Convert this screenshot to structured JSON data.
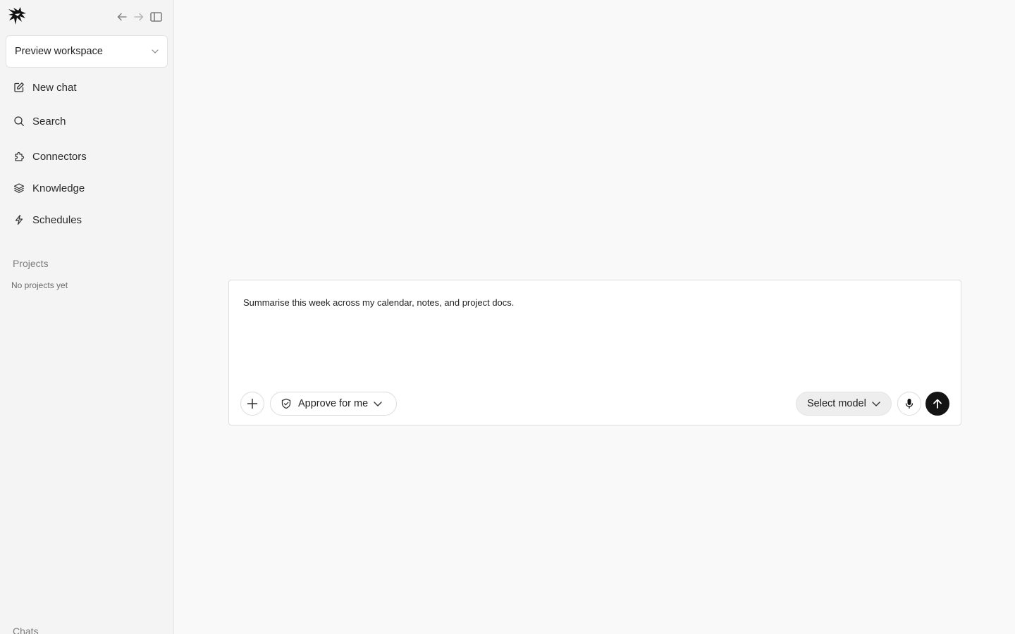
{
  "sidebar": {
    "workspace": {
      "label": "Preview workspace"
    },
    "nav": [
      {
        "label": "New chat",
        "icon": "edit-icon"
      },
      {
        "label": "Search",
        "icon": "search-icon"
      },
      {
        "label": "Connectors",
        "icon": "puzzle-icon"
      },
      {
        "label": "Knowledge",
        "icon": "layers-icon"
      },
      {
        "label": "Schedules",
        "icon": "lightning-icon"
      }
    ],
    "projects": {
      "title": "Projects",
      "empty": "No projects yet"
    },
    "chats": {
      "title": "Chats"
    }
  },
  "composer": {
    "prompt": "Summarise this week across my calendar, notes, and project docs.",
    "approval_mode": "Approve for me",
    "model_select": "Select model"
  },
  "colors": {
    "sidebar_bg": "#f4f4f4",
    "main_bg": "#f9f9f9",
    "send_button": "#141414"
  }
}
